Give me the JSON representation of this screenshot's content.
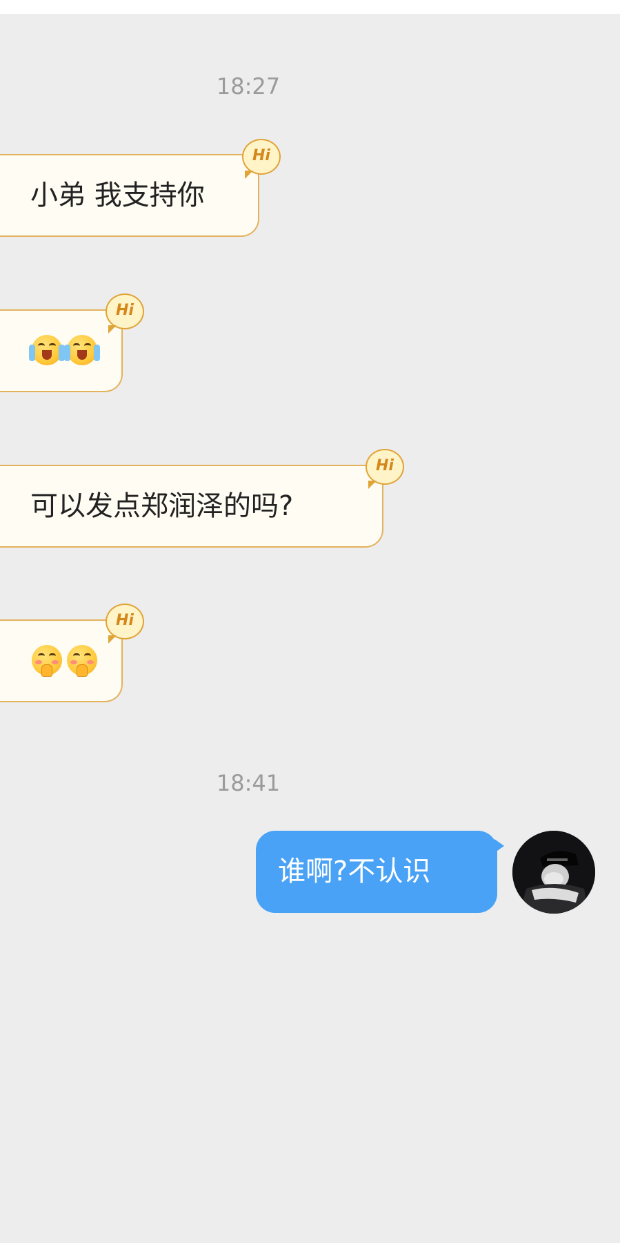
{
  "messages": [
    {
      "side": "incoming",
      "time": "18:27",
      "text": "小弟 我支持你",
      "badge": "Hi"
    },
    {
      "side": "incoming",
      "emoji": [
        "crying-laughing-emoji",
        "crying-laughing-emoji"
      ],
      "badge": "Hi"
    },
    {
      "side": "incoming",
      "text": "可以发点郑润泽的吗?",
      "badge": "Hi"
    },
    {
      "side": "incoming",
      "emoji": [
        "pleading-hands-emoji",
        "pleading-hands-emoji"
      ],
      "badge": "Hi"
    },
    {
      "side": "outgoing",
      "time": "18:41",
      "text": "谁啊?不认识"
    }
  ],
  "colors": {
    "chat_background": "#ededed",
    "incoming_bubble": "#fffcf3",
    "incoming_border": "#e3b25d",
    "outgoing_bubble": "#49a2f5",
    "timestamp": "#9a9a9a",
    "badge_text": "#d4881c"
  }
}
